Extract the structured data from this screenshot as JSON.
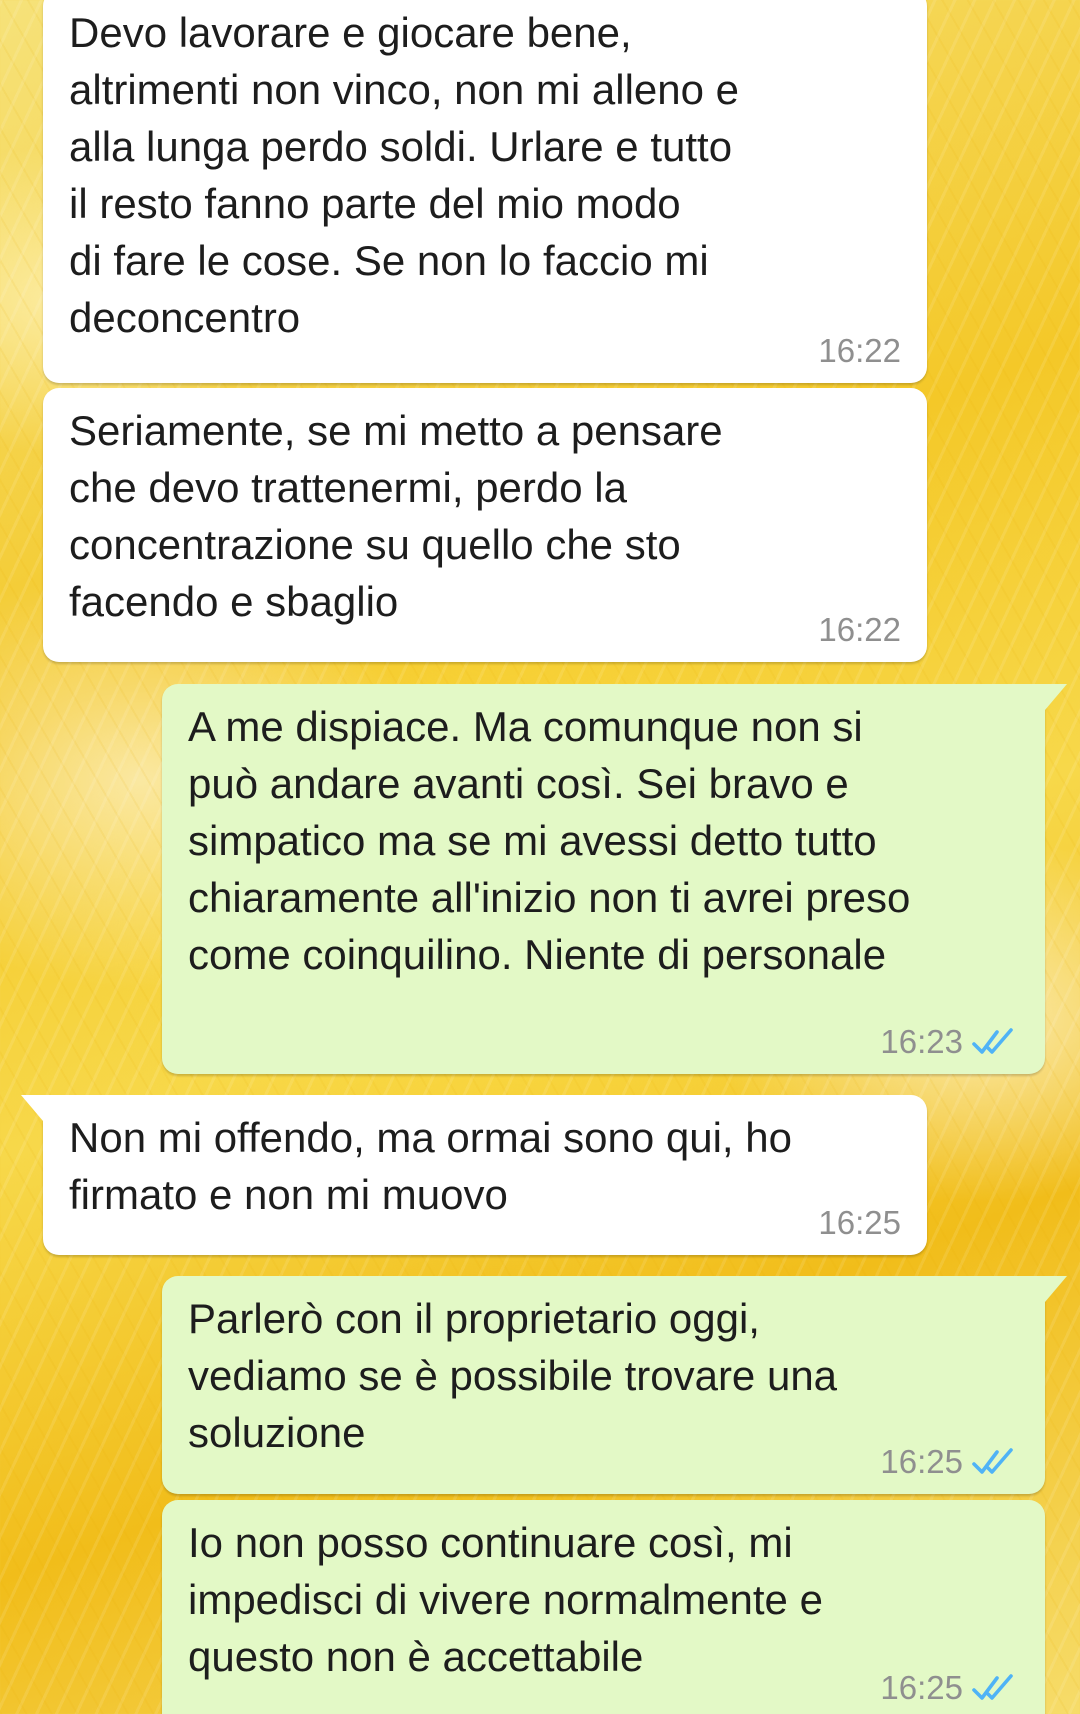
{
  "colors": {
    "incoming_bubble": "#ffffff",
    "outgoing_bubble": "#e3f9c6",
    "timestamp": "#8f8f8f",
    "read_receipt": "#4fb3f6"
  },
  "messages": [
    {
      "direction": "incoming",
      "text": "Devo lavorare e giocare bene,\naltrimenti non vinco, non mi alleno e\nalla lunga perdo soldi. Urlare e tutto\nil resto fanno parte del mio modo\ndi fare le cose. Se non lo faccio mi\ndeconcentro",
      "time": "16:22"
    },
    {
      "direction": "incoming",
      "text": "Seriamente, se mi metto a pensare\nche devo trattenermi, perdo la\nconcentrazione su quello che sto\nfacendo e sbaglio",
      "time": "16:22"
    },
    {
      "direction": "outgoing",
      "text": "A me dispiace. Ma comunque non si\npuò andare avanti così. Sei bravo e\nsimpatico ma se mi avessi detto tutto\nchiaramente all'inizio non ti avrei preso\ncome coinquilino. Niente di personale",
      "time": "16:23",
      "status_icon": "double-check-read-icon"
    },
    {
      "direction": "incoming",
      "text": "Non mi offendo, ma ormai sono qui, ho\nfirmato e non mi muovo",
      "time": "16:25"
    },
    {
      "direction": "outgoing",
      "text": "Parlerò con il proprietario oggi,\nvediamo se è possibile trovare una\nsoluzione",
      "time": "16:25",
      "status_icon": "double-check-read-icon"
    },
    {
      "direction": "outgoing",
      "text": "Io non posso continuare così, mi\nimpedisci di vivere normalmente e\nquesto non è accettabile",
      "time": "16:25",
      "status_icon": "double-check-read-icon"
    }
  ]
}
